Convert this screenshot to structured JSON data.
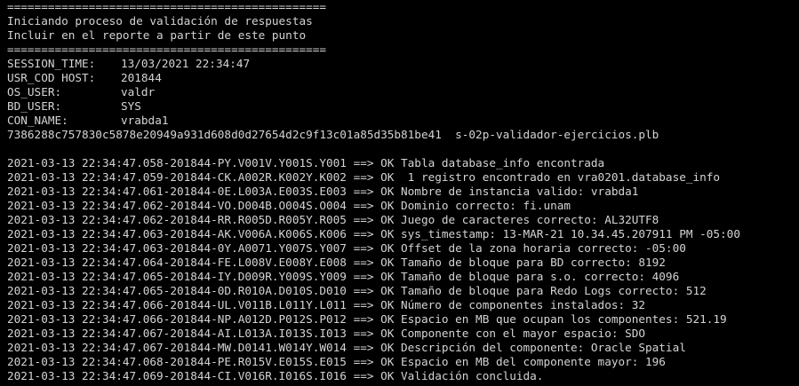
{
  "colors": {
    "background": "#000000",
    "text": "#d4d4d4"
  },
  "header": {
    "separator_top": "===============================================",
    "title_line_1": "Iniciando proceso de validación de respuestas",
    "title_line_2": "Incluir en el reporte a partir de este punto",
    "separator_bottom": "==============================================="
  },
  "session": {
    "fields": [
      {
        "key": "SESSION_TIME:",
        "value": "13/03/2021 22:34:47"
      },
      {
        "key": "USR_COD HOST:",
        "value": "201844"
      },
      {
        "key": "OS_USER:",
        "value": "valdr"
      },
      {
        "key": "BD_USER:",
        "value": "SYS"
      },
      {
        "key": "CON_NAME:",
        "value": "vrabda1"
      }
    ],
    "hash_line": "7386288c757830c5878e20949a931d608d0d27654d2c9f13c01a85d35b81be41  s-02p-validador-ejercicios.plb"
  },
  "log": [
    "2021-03-13 22:34:47.058-201844-PY.V001V.Y001S.Y001 ==> OK Tabla database_info encontrada",
    "2021-03-13 22:34:47.059-201844-CK.A002R.K002Y.K002 ==> OK  1 registro encontrado en vra0201.database_info",
    "2021-03-13 22:34:47.061-201844-0E.L003A.E003S.E003 ==> OK Nombre de instancia valido: vrabda1",
    "2021-03-13 22:34:47.062-201844-VO.D004B.O004S.O004 ==> OK Dominio correcto: fi.unam",
    "2021-03-13 22:34:47.062-201844-RR.R005D.R005Y.R005 ==> OK Juego de caracteres correcto: AL32UTF8",
    "2021-03-13 22:34:47.063-201844-AK.V006A.K006S.K006 ==> OK sys_timestamp: 13-MAR-21 10.34.45.207911 PM -05:00",
    "2021-03-13 22:34:47.063-201844-0Y.A0071.Y007S.Y007 ==> OK Offset de la zona horaria correcto: -05:00",
    "2021-03-13 22:34:47.064-201844-FE.L008V.E008Y.E008 ==> OK Tamaño de bloque para BD correcto: 8192",
    "2021-03-13 22:34:47.065-201844-IY.D009R.Y009S.Y009 ==> OK Tamaño de bloque para s.o. correcto: 4096",
    "2021-03-13 22:34:47.065-201844-0D.R010A.D010S.D010 ==> OK Tamaño de bloque para Redo Logs correcto: 512",
    "2021-03-13 22:34:47.066-201844-UL.V011B.L011Y.L011 ==> OK Número de componentes instalados: 32",
    "2021-03-13 22:34:47.066-201844-NP.A012D.P012S.P012 ==> OK Espacio en MB que ocupan los componentes: 521.19",
    "2021-03-13 22:34:47.067-201844-AI.L013A.I013S.I013 ==> OK Componente con el mayor espacio: SDO",
    "2021-03-13 22:34:47.067-201844-MW.D0141.W014Y.W014 ==> OK Descripción del componente: Oracle Spatial",
    "2021-03-13 22:34:47.068-201844-PE.R015V.E015S.E015 ==> OK Espacio en MB del componente mayor: 196",
    "2021-03-13 22:34:47.069-201844-CI.V016R.I016S.I016 ==> OK Validación concluida."
  ]
}
